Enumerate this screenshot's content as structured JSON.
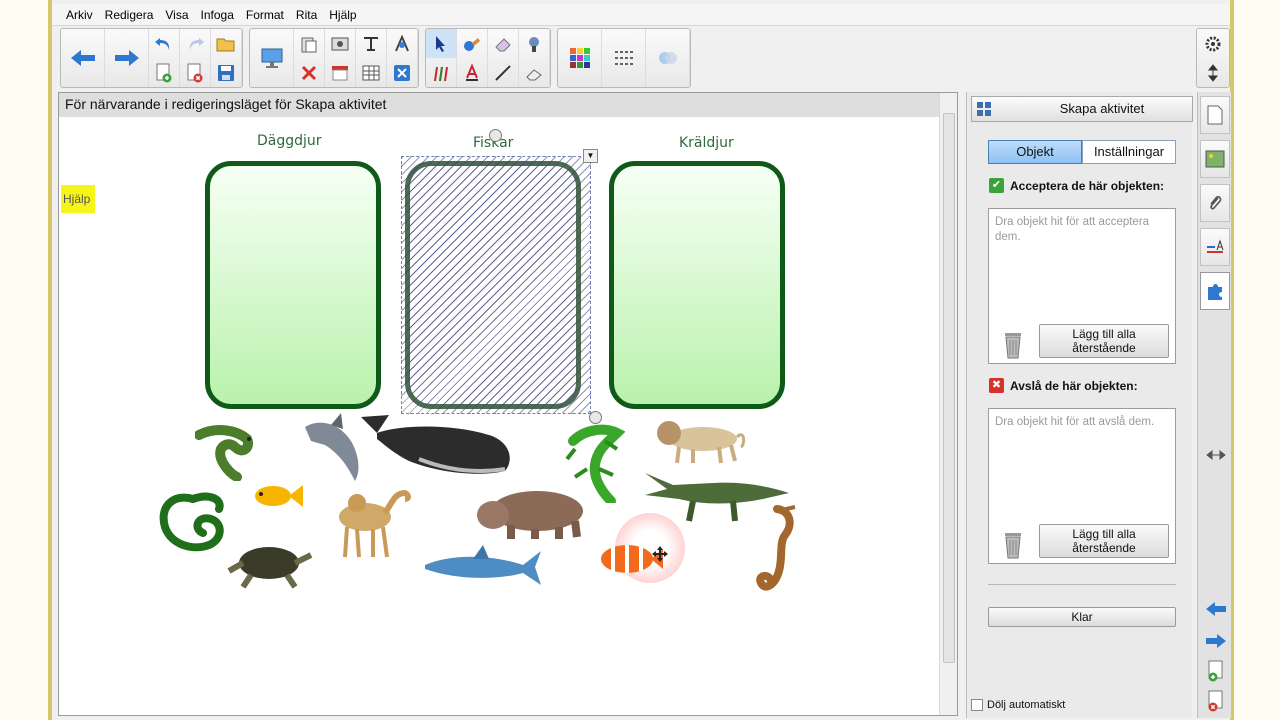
{
  "menu": [
    "Arkiv",
    "Redigera",
    "Visa",
    "Infoga",
    "Format",
    "Rita",
    "Hjälp"
  ],
  "canvas": {
    "header": "För närvarande i redigeringsläget för Skapa aktivitet",
    "help_label": "Hjälp",
    "columns": [
      "Däggdjur",
      "Fiskar",
      "Kräldjur"
    ]
  },
  "panel": {
    "title": "Skapa aktivitet",
    "tabs": [
      "Objekt",
      "Inställningar"
    ],
    "accept_label": "Acceptera de här objekten:",
    "accept_hint": "Dra objekt hit för att acceptera dem.",
    "reject_label": "Avslå de här objekten:",
    "reject_hint": "Dra objekt hit för att avslå dem.",
    "add_remaining": "Lägg till alla återstående",
    "done": "Klar",
    "autohide": "Dölj automatiskt"
  },
  "colors": {
    "box_border": "#0f5a18",
    "box_fill_top": "#f7fff5",
    "box_fill_bottom": "#b9f2ac",
    "tab_active": "#8ec2f3",
    "help_highlight": "#f5f518"
  },
  "icons": {
    "toolbar": [
      "back-arrow-icon",
      "forward-arrow-icon",
      "undo-icon",
      "redo-icon",
      "new-page-icon",
      "delete-page-icon",
      "open-folder-icon",
      "save-icon",
      "display-icon",
      "paste-icon",
      "screen-capture-icon",
      "delete-icon",
      "screen-shade-icon",
      "table-icon",
      "measure-icon",
      "clear-icon",
      "select-icon",
      "pen-icon",
      "fill-icon",
      "text-icon",
      "eraser-icon",
      "line-icon",
      "magic-pen-icon",
      "color-palette-icon",
      "line-style-icon",
      "transparency-icon"
    ]
  }
}
